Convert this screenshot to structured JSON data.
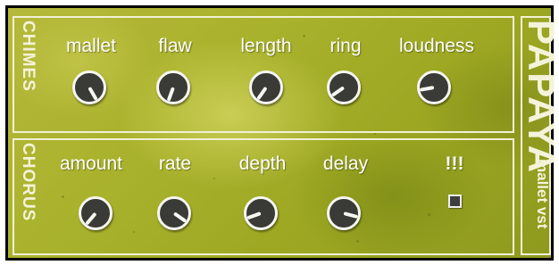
{
  "chimes": {
    "title": "CHIMES",
    "knobs": [
      {
        "label": "mallet",
        "angle": 150
      },
      {
        "label": "flaw",
        "angle": 200
      },
      {
        "label": "length",
        "angle": 215
      },
      {
        "label": "ring",
        "angle": 235
      },
      {
        "label": "loudness",
        "angle": 260
      }
    ]
  },
  "chorus": {
    "title": "CHORUS",
    "knobs": [
      {
        "label": "amount",
        "angle": 220
      },
      {
        "label": "rate",
        "angle": 125
      },
      {
        "label": "depth",
        "angle": 250
      },
      {
        "label": "delay",
        "angle": 105
      }
    ],
    "toggle": {
      "label": "!!!"
    }
  },
  "brand": {
    "name": "PAPAYA",
    "subtitle": "mallet vst"
  },
  "colors": {
    "panel_border": "#f1f0d6",
    "knob_body": "#3a3a36",
    "knob_ring": "#f7f7f2",
    "background": "#a9b22c"
  }
}
